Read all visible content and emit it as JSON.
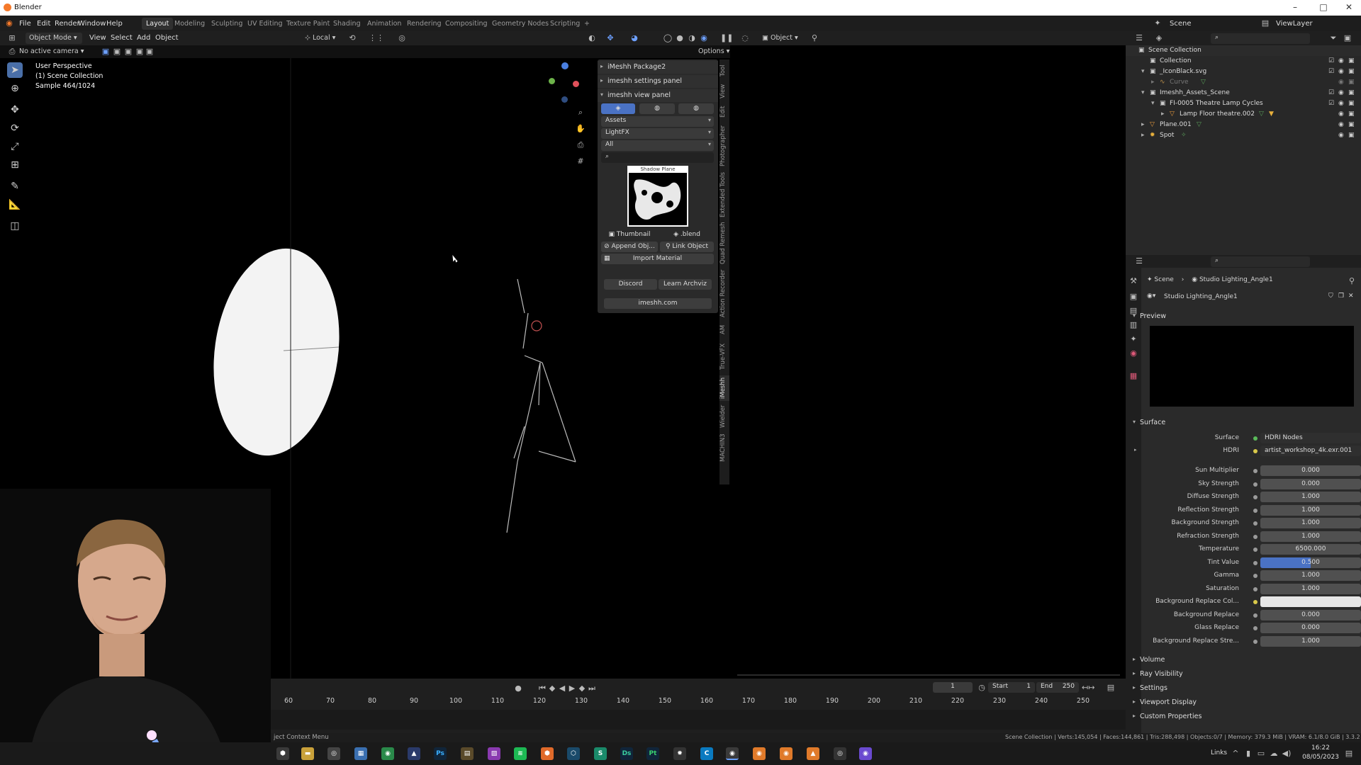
{
  "window": {
    "title": "Blender"
  },
  "menus": [
    "File",
    "Edit",
    "Render",
    "Window",
    "Help"
  ],
  "workspaces": [
    "Layout",
    "Modeling",
    "Sculpting",
    "UV Editing",
    "Texture Paint",
    "Shading",
    "Animation",
    "Rendering",
    "Compositing",
    "Geometry Nodes",
    "Scripting"
  ],
  "active_workspace": "Layout",
  "topright": {
    "scene": "Scene",
    "viewlayer": "ViewLayer"
  },
  "viewport_header": {
    "mode": "Object Mode",
    "menus": [
      "View",
      "Select",
      "Add",
      "Object"
    ],
    "transform": "Local",
    "object_dropdown": "Object",
    "camera": "No active camera",
    "options": "Options"
  },
  "overlay": {
    "perspective": "User Perspective",
    "collection": "(1) Scene Collection",
    "sample": "Sample 464/1024"
  },
  "npanel": {
    "package": "iMeshh Package2",
    "settings": "imeshh settings panel",
    "view": "imeshh view panel",
    "dropdowns": [
      "Assets",
      "LightFX",
      "All"
    ],
    "thumbnail_title": "Shadow Plane",
    "buttons": {
      "thumbnail": "Thumbnail",
      "blend": ".blend",
      "append": "Append Obj...",
      "link": "Link Object",
      "import": "Import Material",
      "discord": "Discord",
      "learn": "Learn Archviz",
      "site": "imeshh.com"
    }
  },
  "side_tabs": [
    "Tool",
    "View",
    "Edit",
    "Photographer",
    "Extended Tools",
    "Quad Remesh",
    "Action Recorder",
    "AM",
    "True-VFX",
    "iMeshh",
    "Wielder",
    "MACHIN3"
  ],
  "outliner": {
    "root": "Scene Collection",
    "rows": [
      {
        "label": "Collection",
        "indent": 1,
        "icon": "collection-icon"
      },
      {
        "label": "_IconBlack.svg",
        "indent": 1,
        "icon": "collection-icon"
      },
      {
        "label": "Curve",
        "indent": 2,
        "icon": "curve-icon"
      },
      {
        "label": "Imeshh_Assets_Scene",
        "indent": 1,
        "icon": "collection-icon"
      },
      {
        "label": "FI-0005 Theatre Lamp Cycles",
        "indent": 2,
        "icon": "collection-icon"
      },
      {
        "label": "Lamp Floor theatre.002",
        "indent": 3,
        "icon": "object-icon"
      },
      {
        "label": "Plane.001",
        "indent": 1,
        "icon": "object-icon"
      },
      {
        "label": "Spot",
        "indent": 1,
        "icon": "light-icon"
      }
    ]
  },
  "properties": {
    "breadcrumb": [
      "Scene",
      "Studio Lighting_Angle1"
    ],
    "world_name": "Studio Lighting_Angle1",
    "preview": "Preview",
    "surface_section": "Surface",
    "surface_value": "HDRI Nodes",
    "hdri_label": "HDRI",
    "hdri_value": "artist_workshop_4k.exr.001",
    "rows": [
      {
        "label": "Sun Multiplier",
        "value": "0.000"
      },
      {
        "label": "Sky Strength",
        "value": "0.000"
      },
      {
        "label": "Diffuse Strength",
        "value": "1.000"
      },
      {
        "label": "Reflection Strength",
        "value": "1.000"
      },
      {
        "label": "Background Strength",
        "value": "1.000"
      },
      {
        "label": "Refraction Strength",
        "value": "1.000"
      },
      {
        "label": "Temperature",
        "value": "6500.000"
      },
      {
        "label": "Tint Value",
        "value": "0.500"
      },
      {
        "label": "Gamma",
        "value": "1.000"
      },
      {
        "label": "Saturation",
        "value": "1.000"
      },
      {
        "label": "Background Replace Col...",
        "value": ""
      },
      {
        "label": "Background Replace",
        "value": "0.000"
      },
      {
        "label": "Glass Replace",
        "value": "0.000"
      },
      {
        "label": "Background Replace Stre...",
        "value": "1.000"
      }
    ],
    "sections": [
      "Volume",
      "Ray Visibility",
      "Settings",
      "Viewport Display",
      "Custom Properties"
    ]
  },
  "timeline": {
    "current_frame": "1",
    "start_label": "Start",
    "start": "1",
    "end_label": "End",
    "end": "250",
    "ticks": [
      "60",
      "70",
      "80",
      "90",
      "100",
      "110",
      "120",
      "130",
      "140",
      "150",
      "160",
      "170",
      "180",
      "190",
      "200",
      "210",
      "220",
      "230",
      "240",
      "250"
    ]
  },
  "status": {
    "left": "ject Context Menu",
    "right": "Scene Collection | Verts:145,054 | Faces:144,861 | Tris:288,498 | Objects:0/7 | Memory: 379.3 MiB | VRAM: 6.1/8.0 GiB | 3.3.2"
  },
  "taskbar": {
    "links": "Links",
    "time": "16:22",
    "date": "08/05/2023"
  },
  "colors": {
    "accent": "#4a6fa8",
    "tint_fill": "#4a72c4",
    "panel": "#2a2a2a"
  }
}
